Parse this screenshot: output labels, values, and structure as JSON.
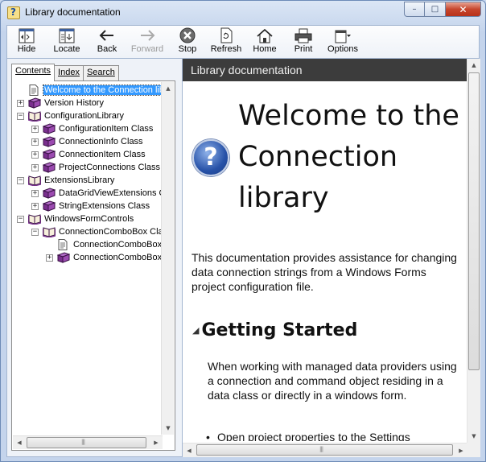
{
  "window": {
    "title": "Library documentation"
  },
  "caption_buttons": {
    "minimize": "–",
    "maximize": "□",
    "close": "✕"
  },
  "toolbar": {
    "buttons": [
      {
        "label": "Hide",
        "icon": "hide-icon",
        "enabled": true
      },
      {
        "label": "Locate",
        "icon": "locate-icon",
        "enabled": true
      },
      {
        "label": "Back",
        "icon": "back-arrow-icon",
        "enabled": true
      },
      {
        "label": "Forward",
        "icon": "forward-arrow-icon",
        "enabled": false
      },
      {
        "label": "Stop",
        "icon": "stop-icon",
        "enabled": true
      },
      {
        "label": "Refresh",
        "icon": "refresh-icon",
        "enabled": true
      },
      {
        "label": "Home",
        "icon": "home-icon",
        "enabled": true
      },
      {
        "label": "Print",
        "icon": "print-icon",
        "enabled": true
      },
      {
        "label": "Options",
        "icon": "options-icon",
        "enabled": true
      }
    ]
  },
  "nav": {
    "tabs": [
      {
        "label": "Contents",
        "active": true
      },
      {
        "label": "Index",
        "active": false
      },
      {
        "label": "Search",
        "active": false
      }
    ],
    "tree": [
      {
        "label": "Welcome to the Connection library",
        "level": 0,
        "icon": "page-icon",
        "expander": "",
        "selected": true
      },
      {
        "label": "Version History",
        "level": 0,
        "icon": "closed-book-icon",
        "expander": "+",
        "selected": false
      },
      {
        "label": "ConfigurationLibrary",
        "level": 0,
        "icon": "open-book-icon",
        "expander": "−",
        "selected": false
      },
      {
        "label": "ConfigurationItem Class",
        "level": 1,
        "icon": "closed-book-icon",
        "expander": "+",
        "selected": false
      },
      {
        "label": "ConnectionInfo Class",
        "level": 1,
        "icon": "closed-book-icon",
        "expander": "+",
        "selected": false
      },
      {
        "label": "ConnectionItem Class",
        "level": 1,
        "icon": "closed-book-icon",
        "expander": "+",
        "selected": false
      },
      {
        "label": "ProjectConnections Class",
        "level": 1,
        "icon": "closed-book-icon",
        "expander": "+",
        "selected": false
      },
      {
        "label": "ExtensionsLibrary",
        "level": 0,
        "icon": "open-book-icon",
        "expander": "−",
        "selected": false
      },
      {
        "label": "DataGridViewExtensions Class",
        "level": 1,
        "icon": "closed-book-icon",
        "expander": "+",
        "selected": false
      },
      {
        "label": "StringExtensions Class",
        "level": 1,
        "icon": "closed-book-icon",
        "expander": "+",
        "selected": false
      },
      {
        "label": "WindowsFormControls",
        "level": 0,
        "icon": "open-book-icon",
        "expander": "−",
        "selected": false
      },
      {
        "label": "ConnectionComboBox Class",
        "level": 1,
        "icon": "open-book-icon",
        "expander": "−",
        "selected": false
      },
      {
        "label": "ConnectionComboBox",
        "level": 2,
        "icon": "page-icon",
        "expander": "",
        "selected": false
      },
      {
        "label": "ConnectionComboBox",
        "level": 2,
        "icon": "closed-book-icon",
        "expander": "+",
        "selected": false
      }
    ]
  },
  "doc": {
    "header": "Library documentation",
    "title": "Welcome to the Connection library",
    "intro": "This documentation provides assistance for changing data connection strings from a Windows Forms project configuration file.",
    "section_heading": "Getting Started",
    "section_text": "When working with managed data providers using a connection and command object residing in a data class or directly in a windows form.",
    "bullet": "Open project properties to the Settings"
  },
  "colors": {
    "selection": "#3399ff",
    "doc_header_bg": "#3c3c3c",
    "book_purple": "#7a2f8e",
    "frame_blue": "#c4d4ec"
  }
}
